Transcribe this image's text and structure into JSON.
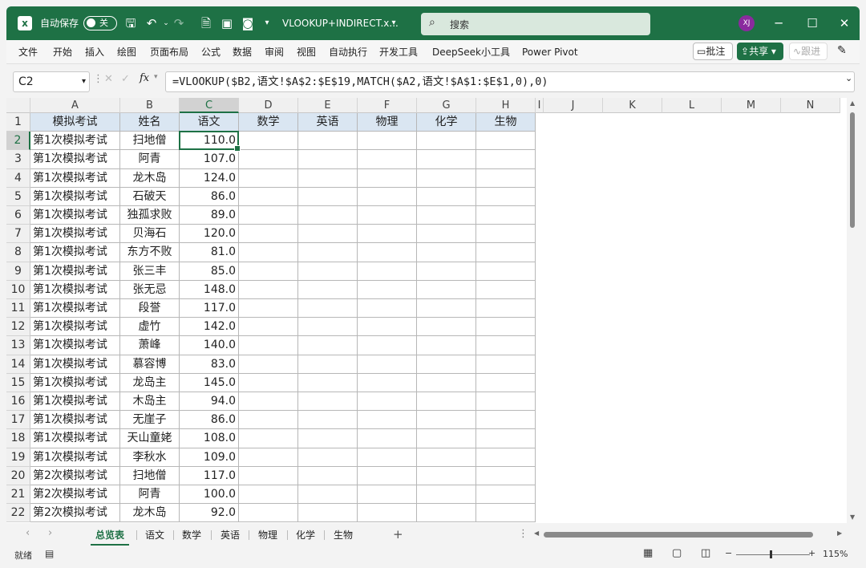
{
  "titlebar": {
    "autosave_label": "自动保存",
    "autosave_state": "关",
    "file_name": "VLOOKUP+INDIRECT.x...",
    "search_placeholder": "搜索",
    "avatar_initials": "XJ",
    "accent_color": "#1e7145"
  },
  "ribbon": {
    "tabs": [
      "文件",
      "开始",
      "插入",
      "绘图",
      "页面布局",
      "公式",
      "数据",
      "审阅",
      "视图",
      "自动执行",
      "开发工具",
      "DeepSeek小工具",
      "Power Pivot"
    ],
    "comment_button": "批注",
    "share_button": "共享",
    "track_button": "跟进"
  },
  "formula_bar": {
    "name_box": "C2",
    "fx_label": "fx",
    "formula": "=VLOOKUP($B2,语文!$A$2:$E$19,MATCH($A2,语文!$A$1:$E$1,0),0)"
  },
  "sheet": {
    "columns": [
      "A",
      "B",
      "C",
      "D",
      "E",
      "F",
      "G",
      "H",
      "I",
      "J",
      "K",
      "L",
      "M",
      "N"
    ],
    "headers": [
      "模拟考试",
      "姓名",
      "语文",
      "数学",
      "英语",
      "物理",
      "化学",
      "生物"
    ],
    "row_numbers": [
      "1",
      "2",
      "3",
      "4",
      "5",
      "6",
      "7",
      "8",
      "9",
      "10",
      "11",
      "12",
      "13",
      "14",
      "15",
      "16",
      "17",
      "18",
      "19",
      "20",
      "21",
      "22"
    ],
    "rows": [
      [
        "第1次模拟考试",
        "扫地僧",
        "110.0"
      ],
      [
        "第1次模拟考试",
        "阿青",
        "107.0"
      ],
      [
        "第1次模拟考试",
        "龙木岛",
        "124.0"
      ],
      [
        "第1次模拟考试",
        "石破天",
        "86.0"
      ],
      [
        "第1次模拟考试",
        "独孤求败",
        "89.0"
      ],
      [
        "第1次模拟考试",
        "贝海石",
        "120.0"
      ],
      [
        "第1次模拟考试",
        "东方不败",
        "81.0"
      ],
      [
        "第1次模拟考试",
        "张三丰",
        "85.0"
      ],
      [
        "第1次模拟考试",
        "张无忌",
        "148.0"
      ],
      [
        "第1次模拟考试",
        "段誉",
        "117.0"
      ],
      [
        "第1次模拟考试",
        "虚竹",
        "142.0"
      ],
      [
        "第1次模拟考试",
        "萧峰",
        "140.0"
      ],
      [
        "第1次模拟考试",
        "慕容博",
        "83.0"
      ],
      [
        "第1次模拟考试",
        "龙岛主",
        "145.0"
      ],
      [
        "第1次模拟考试",
        "木岛主",
        "94.0"
      ],
      [
        "第1次模拟考试",
        "无崖子",
        "86.0"
      ],
      [
        "第1次模拟考试",
        "天山童姥",
        "108.0"
      ],
      [
        "第1次模拟考试",
        "李秋水",
        "109.0"
      ],
      [
        "第2次模拟考试",
        "扫地僧",
        "117.0"
      ],
      [
        "第2次模拟考试",
        "阿青",
        "100.0"
      ],
      [
        "第2次模拟考试",
        "龙木岛",
        "92.0"
      ]
    ]
  },
  "sheet_tabs": [
    "总览表",
    "语文",
    "数学",
    "英语",
    "物理",
    "化学",
    "生物"
  ],
  "active_tab": "总览表",
  "add_sheet": "+",
  "status": {
    "ready": "就绪",
    "zoom": "115%"
  }
}
